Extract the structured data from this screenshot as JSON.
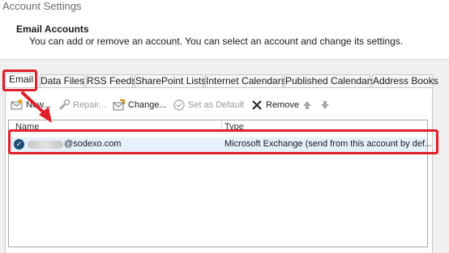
{
  "window": {
    "title": "Account Settings"
  },
  "header": {
    "title": "Email Accounts",
    "description": "You can add or remove an account. You can select an account and change its settings."
  },
  "tabs": [
    {
      "label": "Email",
      "active": true
    },
    {
      "label": "Data Files"
    },
    {
      "label": "RSS Feeds"
    },
    {
      "label": "SharePoint Lists"
    },
    {
      "label": "Internet Calendars"
    },
    {
      "label": "Published Calendars"
    },
    {
      "label": "Address Books"
    }
  ],
  "toolbar": {
    "new_label": "New...",
    "repair_label": "Repair...",
    "change_label": "Change...",
    "default_label": "Set as Default",
    "remove_label": "Remove"
  },
  "list": {
    "col_name": "Name",
    "col_type": "Type",
    "rows": [
      {
        "name": "@sodexo.com",
        "type": "Microsoft Exchange (send from this account by def..."
      }
    ]
  },
  "colors": {
    "annotation_red": "#e0202a",
    "selected_row": "#e5f0fb"
  }
}
